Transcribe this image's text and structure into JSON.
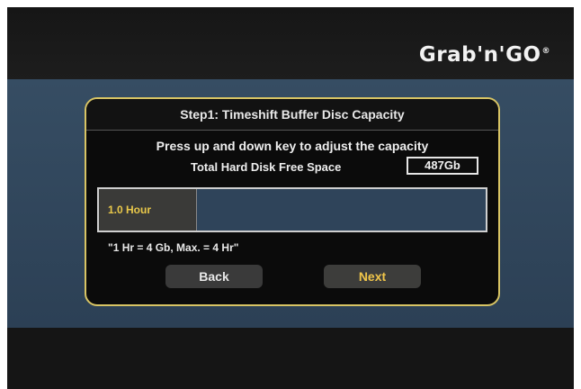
{
  "header": {
    "logo_text": "Grab'n'GO",
    "logo_mark": "®"
  },
  "dialog": {
    "title": "Step1: Timeshift Buffer Disc Capacity",
    "instruction": "Press up and down key to adjust the capacity",
    "free_space_label": "Total Hard Disk Free Space",
    "free_space_value": "487Gb",
    "capacity": {
      "label": "1.0 Hour",
      "level_fraction": 0.25
    },
    "note": "\"1 Hr = 4 Gb, Max. = 4 Hr\"",
    "buttons": {
      "back": "Back",
      "next": "Next"
    }
  },
  "colors": {
    "frame_border": "#d8c464",
    "highlight_text": "#f0c54a",
    "band": "#364d63"
  }
}
